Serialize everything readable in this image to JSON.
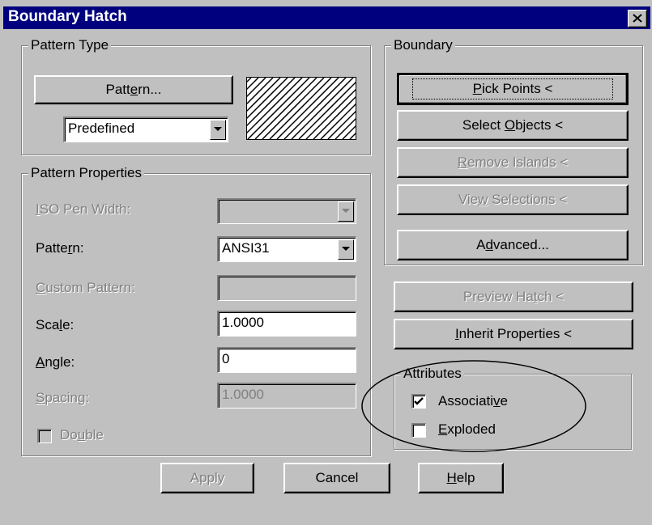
{
  "window": {
    "title": "Boundary Hatch",
    "close_label": "X"
  },
  "pattern_type": {
    "legend": "Pattern Type",
    "pattern_button": {
      "pre": "Patt",
      "u": "e",
      "post": "rn..."
    },
    "type_select": "Predefined"
  },
  "pattern_properties": {
    "legend": "Pattern Properties",
    "iso_pen_width": {
      "u": "I",
      "post": "SO Pen Width:",
      "value": ""
    },
    "pattern": {
      "pre": "Patte",
      "u": "r",
      "post": "n:",
      "value": "ANSI31"
    },
    "custom_pattern": {
      "u": "C",
      "post": "ustom Pattern:",
      "value": ""
    },
    "scale": {
      "pre": "Sca",
      "u": "l",
      "post": "e:",
      "value": "1.0000"
    },
    "angle": {
      "u": "A",
      "post": "ngle:",
      "value": "0"
    },
    "spacing": {
      "u": "S",
      "post": "pacing:",
      "value": "1.0000"
    },
    "double": {
      "pre": "Do",
      "u": "u",
      "post": "ble",
      "checked": false
    }
  },
  "boundary": {
    "legend": "Boundary",
    "pick_points": {
      "u": "P",
      "post": "ick Points <"
    },
    "select_objects": {
      "pre": "Select ",
      "u": "O",
      "post": "bjects <"
    },
    "remove_islands": {
      "u": "R",
      "post": "emove Islands <"
    },
    "view_selections": {
      "pre": "Vie",
      "u": "w",
      "post": " Selections <"
    },
    "advanced": {
      "pre": "A",
      "u": "d",
      "post": "vanced..."
    }
  },
  "preview_hatch": {
    "pre": "Preview Ha",
    "u": "t",
    "post": "ch <"
  },
  "inherit_properties": {
    "u": "I",
    "post": "nherit Properties <"
  },
  "attributes": {
    "legend": "Attributes",
    "associative": {
      "pre": "Associati",
      "u": "v",
      "post": "e",
      "checked": true
    },
    "exploded": {
      "u": "E",
      "post": "xploded",
      "checked": false
    }
  },
  "footer": {
    "apply": "Apply",
    "cancel": "Cancel",
    "help": {
      "u": "H",
      "post": "elp"
    }
  },
  "colors": {
    "title_bar": "#00007f",
    "face": "#c0c0c0",
    "disabled_text": "#808080"
  }
}
